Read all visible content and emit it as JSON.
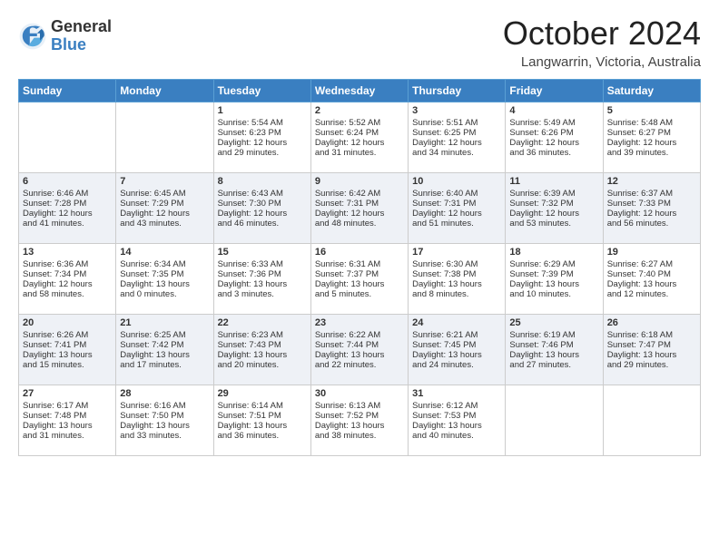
{
  "header": {
    "logo_general": "General",
    "logo_blue": "Blue",
    "title": "October 2024",
    "location": "Langwarrin, Victoria, Australia"
  },
  "days_of_week": [
    "Sunday",
    "Monday",
    "Tuesday",
    "Wednesday",
    "Thursday",
    "Friday",
    "Saturday"
  ],
  "weeks": [
    [
      {
        "day": "",
        "info": ""
      },
      {
        "day": "",
        "info": ""
      },
      {
        "day": "1",
        "info": "Sunrise: 5:54 AM\nSunset: 6:23 PM\nDaylight: 12 hours\nand 29 minutes."
      },
      {
        "day": "2",
        "info": "Sunrise: 5:52 AM\nSunset: 6:24 PM\nDaylight: 12 hours\nand 31 minutes."
      },
      {
        "day": "3",
        "info": "Sunrise: 5:51 AM\nSunset: 6:25 PM\nDaylight: 12 hours\nand 34 minutes."
      },
      {
        "day": "4",
        "info": "Sunrise: 5:49 AM\nSunset: 6:26 PM\nDaylight: 12 hours\nand 36 minutes."
      },
      {
        "day": "5",
        "info": "Sunrise: 5:48 AM\nSunset: 6:27 PM\nDaylight: 12 hours\nand 39 minutes."
      }
    ],
    [
      {
        "day": "6",
        "info": "Sunrise: 6:46 AM\nSunset: 7:28 PM\nDaylight: 12 hours\nand 41 minutes."
      },
      {
        "day": "7",
        "info": "Sunrise: 6:45 AM\nSunset: 7:29 PM\nDaylight: 12 hours\nand 43 minutes."
      },
      {
        "day": "8",
        "info": "Sunrise: 6:43 AM\nSunset: 7:30 PM\nDaylight: 12 hours\nand 46 minutes."
      },
      {
        "day": "9",
        "info": "Sunrise: 6:42 AM\nSunset: 7:31 PM\nDaylight: 12 hours\nand 48 minutes."
      },
      {
        "day": "10",
        "info": "Sunrise: 6:40 AM\nSunset: 7:31 PM\nDaylight: 12 hours\nand 51 minutes."
      },
      {
        "day": "11",
        "info": "Sunrise: 6:39 AM\nSunset: 7:32 PM\nDaylight: 12 hours\nand 53 minutes."
      },
      {
        "day": "12",
        "info": "Sunrise: 6:37 AM\nSunset: 7:33 PM\nDaylight: 12 hours\nand 56 minutes."
      }
    ],
    [
      {
        "day": "13",
        "info": "Sunrise: 6:36 AM\nSunset: 7:34 PM\nDaylight: 12 hours\nand 58 minutes."
      },
      {
        "day": "14",
        "info": "Sunrise: 6:34 AM\nSunset: 7:35 PM\nDaylight: 13 hours\nand 0 minutes."
      },
      {
        "day": "15",
        "info": "Sunrise: 6:33 AM\nSunset: 7:36 PM\nDaylight: 13 hours\nand 3 minutes."
      },
      {
        "day": "16",
        "info": "Sunrise: 6:31 AM\nSunset: 7:37 PM\nDaylight: 13 hours\nand 5 minutes."
      },
      {
        "day": "17",
        "info": "Sunrise: 6:30 AM\nSunset: 7:38 PM\nDaylight: 13 hours\nand 8 minutes."
      },
      {
        "day": "18",
        "info": "Sunrise: 6:29 AM\nSunset: 7:39 PM\nDaylight: 13 hours\nand 10 minutes."
      },
      {
        "day": "19",
        "info": "Sunrise: 6:27 AM\nSunset: 7:40 PM\nDaylight: 13 hours\nand 12 minutes."
      }
    ],
    [
      {
        "day": "20",
        "info": "Sunrise: 6:26 AM\nSunset: 7:41 PM\nDaylight: 13 hours\nand 15 minutes."
      },
      {
        "day": "21",
        "info": "Sunrise: 6:25 AM\nSunset: 7:42 PM\nDaylight: 13 hours\nand 17 minutes."
      },
      {
        "day": "22",
        "info": "Sunrise: 6:23 AM\nSunset: 7:43 PM\nDaylight: 13 hours\nand 20 minutes."
      },
      {
        "day": "23",
        "info": "Sunrise: 6:22 AM\nSunset: 7:44 PM\nDaylight: 13 hours\nand 22 minutes."
      },
      {
        "day": "24",
        "info": "Sunrise: 6:21 AM\nSunset: 7:45 PM\nDaylight: 13 hours\nand 24 minutes."
      },
      {
        "day": "25",
        "info": "Sunrise: 6:19 AM\nSunset: 7:46 PM\nDaylight: 13 hours\nand 27 minutes."
      },
      {
        "day": "26",
        "info": "Sunrise: 6:18 AM\nSunset: 7:47 PM\nDaylight: 13 hours\nand 29 minutes."
      }
    ],
    [
      {
        "day": "27",
        "info": "Sunrise: 6:17 AM\nSunset: 7:48 PM\nDaylight: 13 hours\nand 31 minutes."
      },
      {
        "day": "28",
        "info": "Sunrise: 6:16 AM\nSunset: 7:50 PM\nDaylight: 13 hours\nand 33 minutes."
      },
      {
        "day": "29",
        "info": "Sunrise: 6:14 AM\nSunset: 7:51 PM\nDaylight: 13 hours\nand 36 minutes."
      },
      {
        "day": "30",
        "info": "Sunrise: 6:13 AM\nSunset: 7:52 PM\nDaylight: 13 hours\nand 38 minutes."
      },
      {
        "day": "31",
        "info": "Sunrise: 6:12 AM\nSunset: 7:53 PM\nDaylight: 13 hours\nand 40 minutes."
      },
      {
        "day": "",
        "info": ""
      },
      {
        "day": "",
        "info": ""
      }
    ]
  ]
}
